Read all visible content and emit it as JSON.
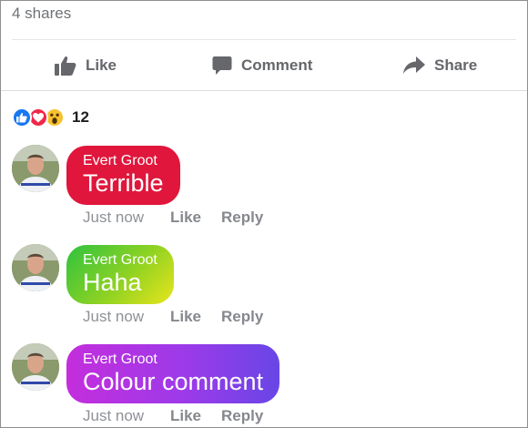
{
  "post": {
    "shares_text": "4 shares",
    "actions": {
      "like_label": "Like",
      "comment_label": "Comment",
      "share_label": "Share"
    },
    "reactions": {
      "types": [
        "like",
        "love",
        "wow"
      ],
      "count": "12"
    }
  },
  "comments": [
    {
      "author": "Evert Groot",
      "text": "Terrible",
      "time": "Just now",
      "like_label": "Like",
      "reply_label": "Reply",
      "bubble_style": "red",
      "colors": [
        "#e0163c"
      ]
    },
    {
      "author": "Evert Groot",
      "text": "Haha",
      "time": "Just now",
      "like_label": "Like",
      "reply_label": "Reply",
      "bubble_style": "green-yellow-gradient",
      "colors": [
        "#2fc23f",
        "#e9e51c"
      ]
    },
    {
      "author": "Evert Groot",
      "text": "Colour comment",
      "time": "Just now",
      "like_label": "Like",
      "reply_label": "Reply",
      "bubble_style": "purple-gradient",
      "colors": [
        "#c42edc",
        "#6846e6"
      ]
    }
  ],
  "colors": {
    "facebook_blue": "#1877f2",
    "love_red": "#f0284a",
    "wow_yellow": "#f7c12f",
    "meta_gray": "#8e9196"
  }
}
